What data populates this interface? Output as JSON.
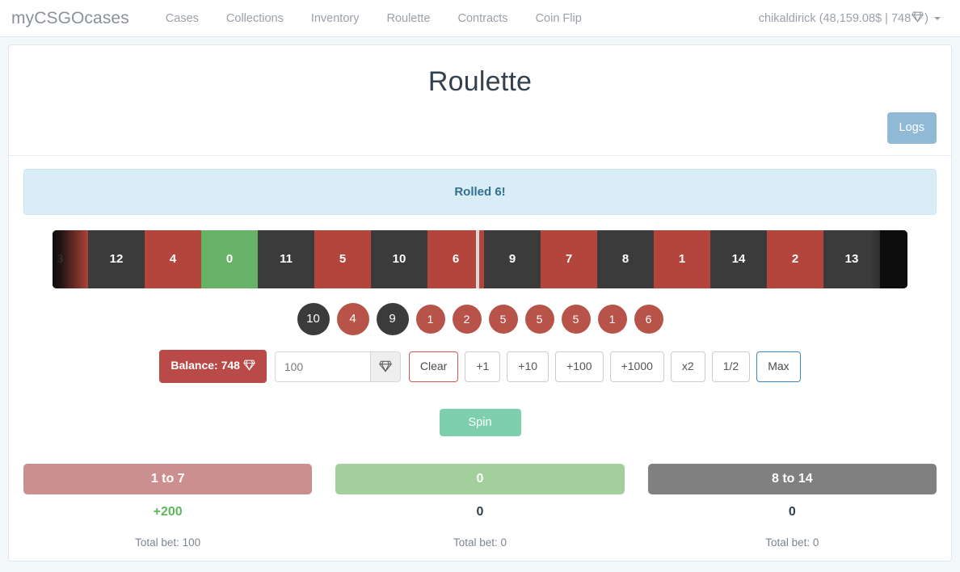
{
  "colors": {
    "page_bg": "#f2f7fa",
    "red": "#b4453c",
    "dark": "#3b3b3b",
    "green": "#66b266",
    "alert_bg": "#d9edf7",
    "alert_text": "#31708f",
    "logs_btn": "#8fb9d4",
    "spin_btn": "#72cca7",
    "bet_low": "#cc8f8f",
    "bet_zero": "#a3cf9c",
    "bet_high": "#808080",
    "win_green": "#5cb85c",
    "balance_btn": "#b94a48"
  },
  "navbar": {
    "brand": "myCSGOcases",
    "links": [
      {
        "label": "Cases"
      },
      {
        "label": "Collections"
      },
      {
        "label": "Inventory"
      },
      {
        "label": "Roulette"
      },
      {
        "label": "Contracts"
      },
      {
        "label": "Coin Flip"
      }
    ],
    "user": {
      "name": "chikaldirick",
      "balance_usd": "48,159.08$",
      "separator": "|",
      "gems": "748",
      "open_paren": "(",
      "close_paren": ")",
      "gem_icon": "gem-icon",
      "caret_icon": "caret-down-icon"
    }
  },
  "page": {
    "title": "Roulette",
    "logs_label": "Logs"
  },
  "alert": {
    "message": "Rolled 6!"
  },
  "wheel": {
    "cells": [
      {
        "value": "3",
        "color": "red"
      },
      {
        "value": "12",
        "color": "dark"
      },
      {
        "value": "4",
        "color": "red"
      },
      {
        "value": "0",
        "color": "green"
      },
      {
        "value": "11",
        "color": "dark"
      },
      {
        "value": "5",
        "color": "red"
      },
      {
        "value": "10",
        "color": "dark"
      },
      {
        "value": "6",
        "color": "red"
      },
      {
        "value": "9",
        "color": "dark"
      },
      {
        "value": "7",
        "color": "red"
      },
      {
        "value": "8",
        "color": "dark"
      },
      {
        "value": "1",
        "color": "red"
      },
      {
        "value": "14",
        "color": "dark"
      },
      {
        "value": "2",
        "color": "red"
      },
      {
        "value": "13",
        "color": "dark"
      }
    ],
    "marker_on_value": "6"
  },
  "history": [
    {
      "value": "10",
      "color": "dark",
      "size": "lg"
    },
    {
      "value": "4",
      "color": "red",
      "size": "lg"
    },
    {
      "value": "9",
      "color": "dark",
      "size": "lg"
    },
    {
      "value": "1",
      "color": "red",
      "size": "sm"
    },
    {
      "value": "2",
      "color": "red",
      "size": "sm"
    },
    {
      "value": "5",
      "color": "red",
      "size": "sm"
    },
    {
      "value": "5",
      "color": "red",
      "size": "sm"
    },
    {
      "value": "5",
      "color": "red",
      "size": "sm"
    },
    {
      "value": "1",
      "color": "red",
      "size": "sm"
    },
    {
      "value": "6",
      "color": "red",
      "size": "sm"
    }
  ],
  "controls": {
    "balance_label": "Balance: 748",
    "balance_gem_icon": "gem-icon",
    "bet_value": "100",
    "bet_placeholder": "100",
    "addon_icon": "gem-icon",
    "buttons": [
      {
        "label": "Clear",
        "style": "danger"
      },
      {
        "label": "+1",
        "style": "default"
      },
      {
        "label": "+10",
        "style": "default"
      },
      {
        "label": "+100",
        "style": "default"
      },
      {
        "label": "+1000",
        "style": "default"
      },
      {
        "label": "x2",
        "style": "default"
      },
      {
        "label": "1/2",
        "style": "default"
      },
      {
        "label": "Max",
        "style": "primary"
      }
    ],
    "spin_label": "Spin"
  },
  "bet_areas": [
    {
      "label": "1 to 7",
      "style": "low",
      "winnings": "+200",
      "winnings_positive": true,
      "total": "Total bet: 100"
    },
    {
      "label": "0",
      "style": "zero",
      "winnings": "0",
      "winnings_positive": false,
      "total": "Total bet: 0"
    },
    {
      "label": "8 to 14",
      "style": "high",
      "winnings": "0",
      "winnings_positive": false,
      "total": "Total bet: 0"
    }
  ]
}
